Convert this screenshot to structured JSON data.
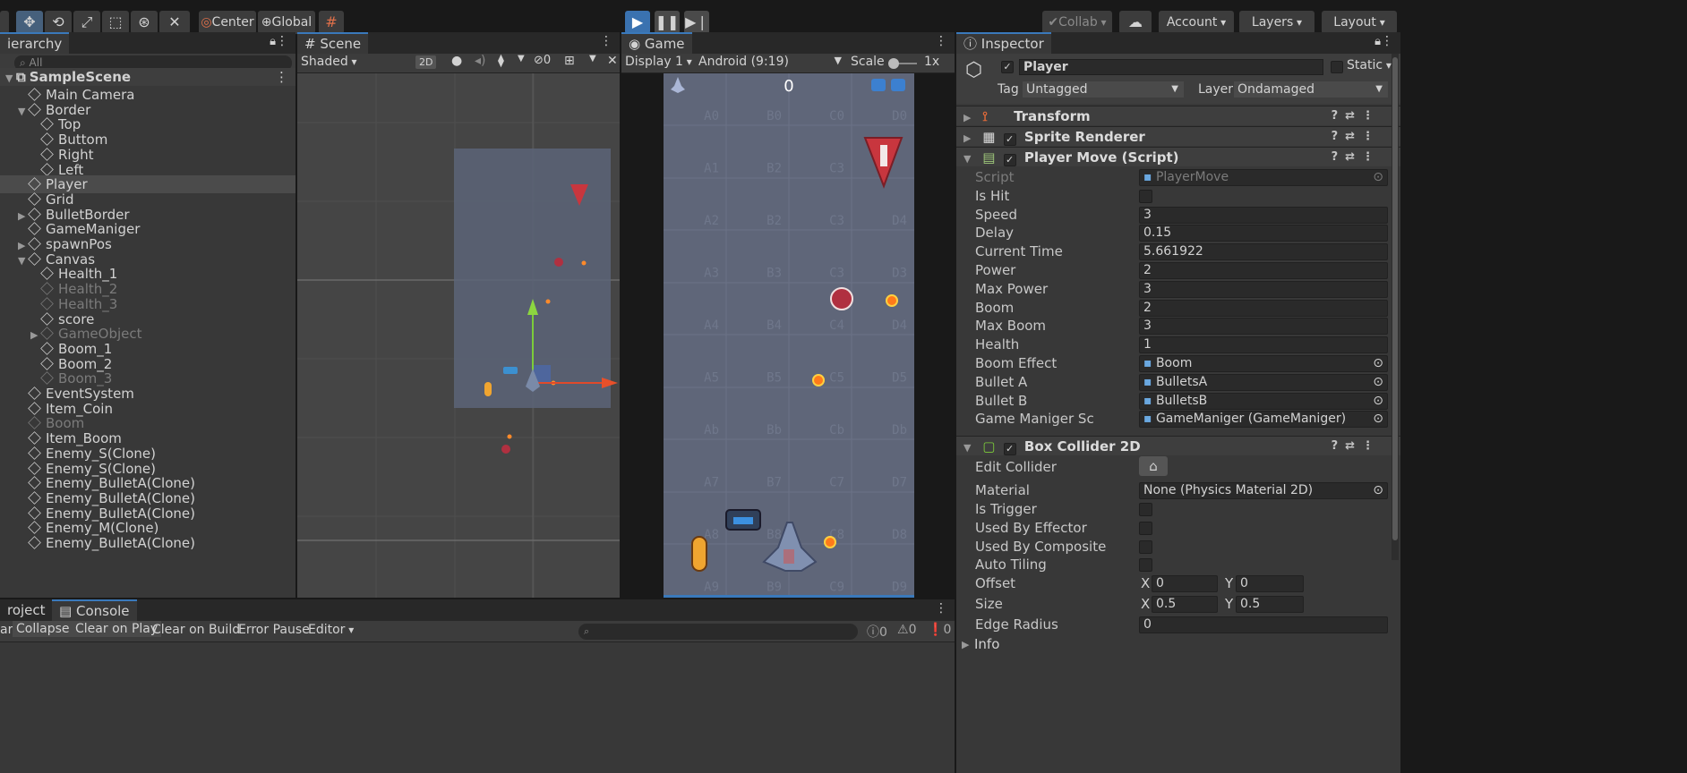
{
  "toolbar": {
    "center_label": "Center",
    "global_label": "Global",
    "collab_label": "Collab",
    "account_label": "Account",
    "layers_label": "Layers",
    "layout_label": "Layout"
  },
  "hierarchy": {
    "tab_label": "ierarchy",
    "search_placeholder": "All",
    "scene_name": "SampleScene",
    "items": [
      {
        "label": "Main Camera",
        "indent": 1,
        "arrow": false,
        "dim": false
      },
      {
        "label": "Border",
        "indent": 1,
        "arrow": true,
        "open": true,
        "dim": false
      },
      {
        "label": "Top",
        "indent": 2,
        "arrow": false,
        "dim": false
      },
      {
        "label": "Buttom",
        "indent": 2,
        "arrow": false,
        "dim": false
      },
      {
        "label": "Right",
        "indent": 2,
        "arrow": false,
        "dim": false
      },
      {
        "label": "Left",
        "indent": 2,
        "arrow": false,
        "dim": false
      },
      {
        "label": "Player",
        "indent": 1,
        "arrow": false,
        "dim": false,
        "selected": true
      },
      {
        "label": "Grid",
        "indent": 1,
        "arrow": false,
        "dim": false
      },
      {
        "label": "BulletBorder",
        "indent": 1,
        "arrow": true,
        "open": false,
        "dim": false
      },
      {
        "label": "GameManiger",
        "indent": 1,
        "arrow": false,
        "dim": false
      },
      {
        "label": "spawnPos",
        "indent": 1,
        "arrow": true,
        "open": false,
        "dim": false
      },
      {
        "label": "Canvas",
        "indent": 1,
        "arrow": true,
        "open": true,
        "dim": false
      },
      {
        "label": "Health_1",
        "indent": 2,
        "arrow": false,
        "dim": false
      },
      {
        "label": "Health_2",
        "indent": 2,
        "arrow": false,
        "dim": true
      },
      {
        "label": "Health_3",
        "indent": 2,
        "arrow": false,
        "dim": true
      },
      {
        "label": "score",
        "indent": 2,
        "arrow": false,
        "dim": false
      },
      {
        "label": "GameObject",
        "indent": 2,
        "arrow": true,
        "open": false,
        "dim": true
      },
      {
        "label": "Boom_1",
        "indent": 2,
        "arrow": false,
        "dim": false
      },
      {
        "label": "Boom_2",
        "indent": 2,
        "arrow": false,
        "dim": false
      },
      {
        "label": "Boom_3",
        "indent": 2,
        "arrow": false,
        "dim": true
      },
      {
        "label": "EventSystem",
        "indent": 1,
        "arrow": false,
        "dim": false
      },
      {
        "label": "Item_Coin",
        "indent": 1,
        "arrow": false,
        "dim": false
      },
      {
        "label": "Boom",
        "indent": 1,
        "arrow": false,
        "dim": true
      },
      {
        "label": "Item_Boom",
        "indent": 1,
        "arrow": false,
        "dim": false
      },
      {
        "label": "Enemy_S(Clone)",
        "indent": 1,
        "arrow": false,
        "dim": false
      },
      {
        "label": "Enemy_S(Clone)",
        "indent": 1,
        "arrow": false,
        "dim": false
      },
      {
        "label": "Enemy_BulletA(Clone)",
        "indent": 1,
        "arrow": false,
        "dim": false
      },
      {
        "label": "Enemy_BulletA(Clone)",
        "indent": 1,
        "arrow": false,
        "dim": false
      },
      {
        "label": "Enemy_BulletA(Clone)",
        "indent": 1,
        "arrow": false,
        "dim": false
      },
      {
        "label": "Enemy_M(Clone)",
        "indent": 1,
        "arrow": false,
        "dim": false
      },
      {
        "label": "Enemy_BulletA(Clone)",
        "indent": 1,
        "arrow": false,
        "dim": false
      }
    ]
  },
  "scene": {
    "tab_label": "Scene",
    "shading": "Shaded",
    "mode_2d": "2D",
    "hidden_count": "0"
  },
  "game": {
    "tab_label": "Game",
    "display": "Display 1",
    "aspect": "Android (9:19)",
    "scale_label": "Scale",
    "scale_value": "1x",
    "score": "0",
    "grid_labels": [
      [
        "A0",
        "B0",
        "C0",
        "D0"
      ],
      [
        "A1",
        "B2",
        "C3",
        ""
      ],
      [
        "A2",
        "B2",
        "C3",
        "D4"
      ],
      [
        "A3",
        "B3",
        "C3",
        "D3"
      ],
      [
        "A4",
        "B4",
        "C4",
        "D4"
      ],
      [
        "A5",
        "B5",
        "C5",
        "D5"
      ],
      [
        "Ab",
        "Bb",
        "Cb",
        "Db"
      ],
      [
        "A7",
        "B7",
        "C7",
        "D7"
      ],
      [
        "A8",
        "B8",
        "C8",
        "D8"
      ],
      [
        "A9",
        "B9",
        "C9",
        "D9"
      ]
    ]
  },
  "console": {
    "project_tab": "roject",
    "console_tab": "Console",
    "buttons": [
      "ar",
      "Collapse",
      "Clear on Play",
      "Clear on Build",
      "Error Pause",
      "Editor"
    ],
    "log_count": "0",
    "warn_count": "0",
    "error_count": "0"
  },
  "inspector": {
    "tab_label": "Inspector",
    "object_name": "Player",
    "static_label": "Static",
    "tag_label": "Tag",
    "tag_value": "Untagged",
    "layer_label": "Layer",
    "layer_value": "Ondamaged",
    "components": {
      "transform": "Transform",
      "sprite_renderer": "Sprite Renderer",
      "player_move": "Player Move (Script)",
      "box_collider": "Box Collider 2D"
    },
    "player_move_fields": [
      {
        "label": "Script",
        "value": "PlayerMove",
        "kind": "objref",
        "dim": true
      },
      {
        "label": "Is Hit",
        "value": "",
        "kind": "check"
      },
      {
        "label": "Speed",
        "value": "3",
        "kind": "text"
      },
      {
        "label": "Delay",
        "value": "0.15",
        "kind": "text"
      },
      {
        "label": "Current Time",
        "value": "5.661922",
        "kind": "text"
      },
      {
        "label": "Power",
        "value": "2",
        "kind": "text"
      },
      {
        "label": "Max Power",
        "value": "3",
        "kind": "text"
      },
      {
        "label": "Boom",
        "value": "2",
        "kind": "text"
      },
      {
        "label": "Max Boom",
        "value": "3",
        "kind": "text"
      },
      {
        "label": "Health",
        "value": "1",
        "kind": "text"
      },
      {
        "label": "Boom Effect",
        "value": "Boom",
        "kind": "objref"
      },
      {
        "label": "Bullet A",
        "value": "BulletsA",
        "kind": "objref"
      },
      {
        "label": "Bullet B",
        "value": "BulletsB",
        "kind": "objref"
      },
      {
        "label": "Game Maniger Sc",
        "value": "GameManiger (GameManiger)",
        "kind": "objref"
      }
    ],
    "box_collider_fields": [
      {
        "label": "Edit Collider",
        "kind": "button"
      },
      {
        "label": "Material",
        "value": "None (Physics Material 2D)",
        "kind": "objref"
      },
      {
        "label": "Is Trigger",
        "kind": "check"
      },
      {
        "label": "Used By Effector",
        "kind": "check"
      },
      {
        "label": "Used By Composite",
        "kind": "check"
      },
      {
        "label": "Auto Tiling",
        "kind": "check"
      }
    ],
    "offset_label": "Offset",
    "offset_x": "0",
    "offset_y": "0",
    "size_label": "Size",
    "size_x": "0.5",
    "size_y": "0.5",
    "edge_radius_label": "Edge Radius",
    "edge_radius": "0",
    "info_label": "Info",
    "x_label": "X",
    "y_label": "Y"
  },
  "colors": {
    "accent": "#3a79bb",
    "play_active": "#3a72b0",
    "panel": "#383838",
    "game_bg": "#5f6679"
  }
}
